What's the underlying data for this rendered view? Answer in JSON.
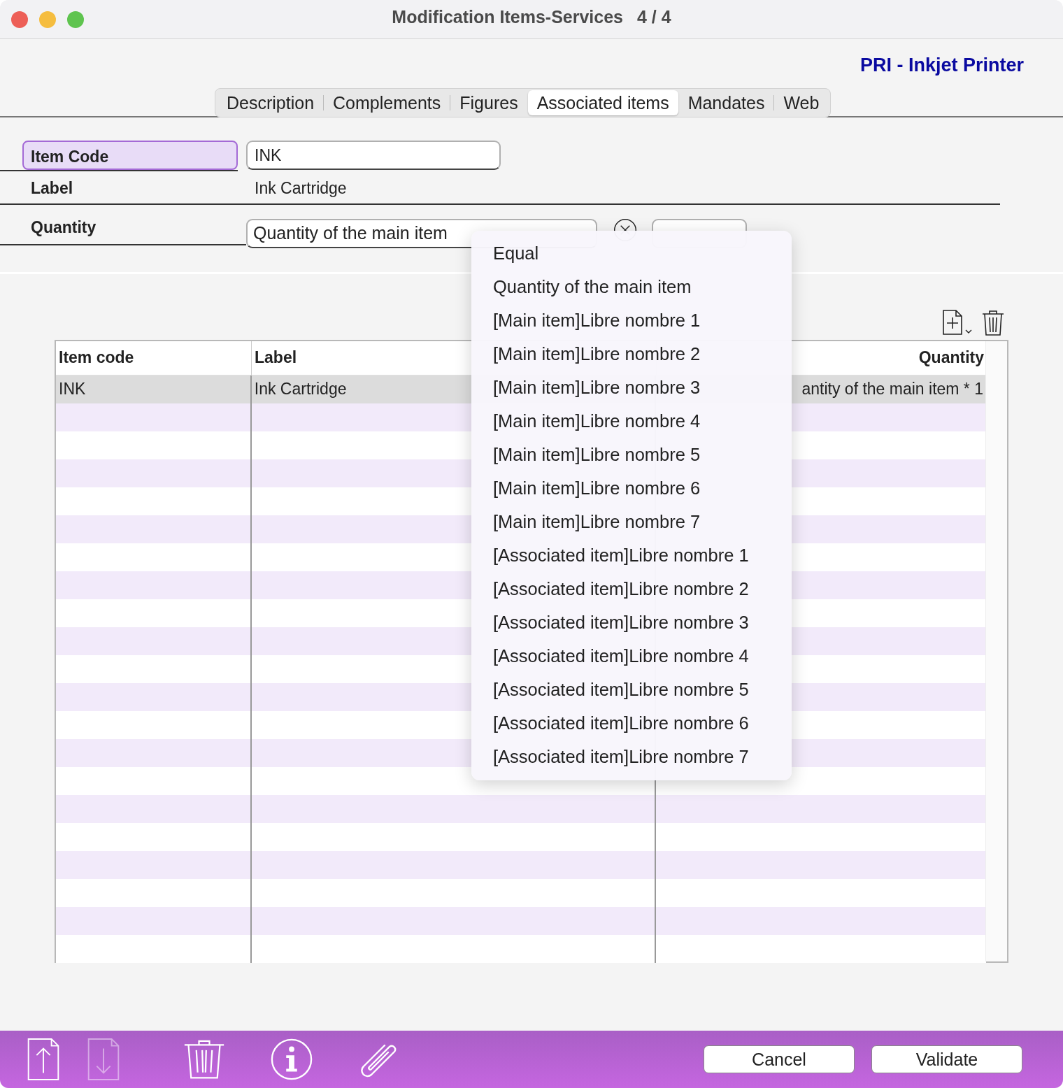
{
  "window": {
    "title": "Modification Items-Services",
    "counter": "4 / 4"
  },
  "record_title": "PRI - Inkjet Printer",
  "tabs": [
    {
      "label": "Description",
      "selected": false
    },
    {
      "label": "Complements",
      "selected": false
    },
    {
      "label": "Figures",
      "selected": false
    },
    {
      "label": "Associated items",
      "selected": true
    },
    {
      "label": "Mandates",
      "selected": false
    },
    {
      "label": "Web",
      "selected": false
    }
  ],
  "form": {
    "item_code": {
      "label": "Item Code",
      "value": "INK",
      "focused": true
    },
    "label": {
      "label": "Label",
      "value": "Ink Cartridge"
    },
    "quantity": {
      "label": "Quantity",
      "value": "Quantity of the main item"
    }
  },
  "table": {
    "columns": [
      {
        "label": "Item code"
      },
      {
        "label": "Label"
      },
      {
        "label": "Quantity"
      }
    ],
    "rows": [
      {
        "cells": [
          "INK",
          "Ink Cartridge",
          "antity of the main item * 1"
        ],
        "selected": true
      }
    ]
  },
  "dropdown": {
    "items": [
      {
        "label": "Equal",
        "selected": false
      },
      {
        "label": "Quantity of the main item",
        "selected": false
      },
      {
        "label": "[Main item]Libre nombre 1",
        "selected": false
      },
      {
        "label": "[Main item]Libre nombre 2",
        "selected": false
      },
      {
        "label": "[Main item]Libre nombre 3",
        "selected": false
      },
      {
        "label": "[Main item]Libre nombre 4",
        "selected": false
      },
      {
        "label": "[Main item]Libre nombre 5",
        "selected": false
      },
      {
        "label": "[Main item]Libre nombre 6",
        "selected": false
      },
      {
        "label": "[Main item]Libre nombre 7",
        "selected": false
      },
      {
        "label": "[Associated item]Libre nombre 1",
        "selected": false
      },
      {
        "label": "[Associated item]Libre nombre 2",
        "selected": false
      },
      {
        "label": "[Associated item]Libre nombre 3",
        "selected": false
      },
      {
        "label": "[Associated item]Libre nombre 4",
        "selected": false
      },
      {
        "label": "[Associated item]Libre nombre 5",
        "selected": false
      },
      {
        "label": "[Associated item]Libre nombre 6",
        "selected": false
      },
      {
        "label": "[Associated item]Libre nombre 7",
        "selected": false
      }
    ]
  },
  "toolbar": [
    {
      "kind": "upload",
      "disabled": false
    },
    {
      "kind": "download",
      "disabled": true
    },
    {
      "kind": "delete",
      "disabled": false
    },
    {
      "kind": "info",
      "disabled": false
    },
    {
      "kind": "attach",
      "disabled": false
    }
  ],
  "buttons": [
    {
      "label": "Cancel"
    },
    {
      "label": "Validate"
    }
  ]
}
